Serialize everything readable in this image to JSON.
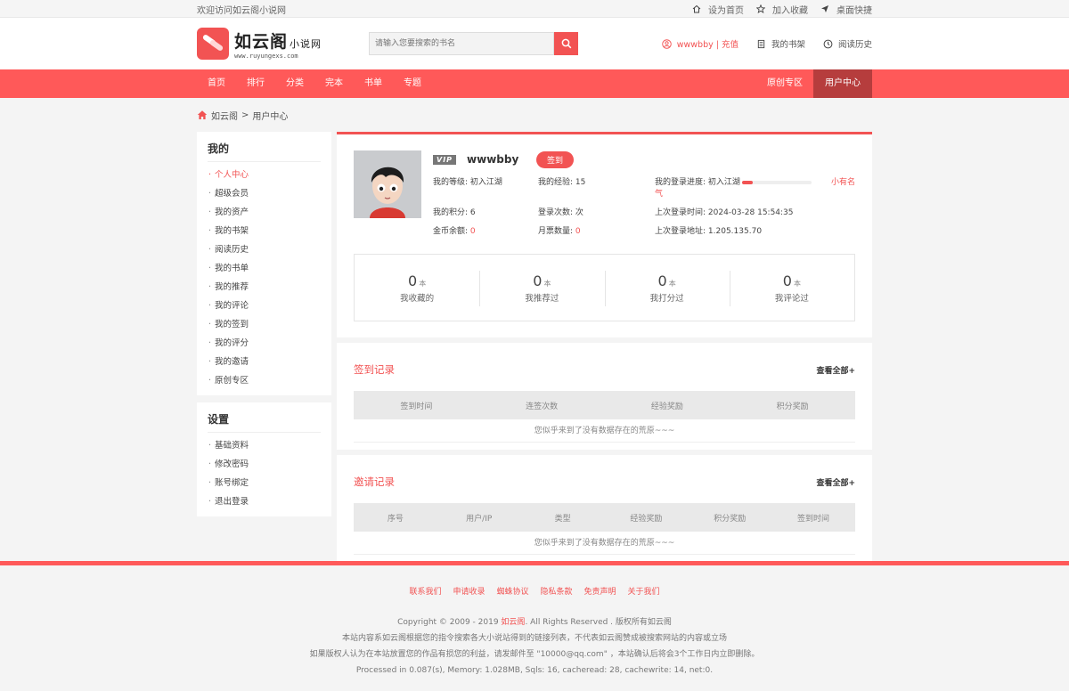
{
  "topbar": {
    "welcome": "欢迎访问如云阁小说网",
    "links": [
      "设为首页",
      "加入收藏",
      "桌面快捷"
    ]
  },
  "header": {
    "logo_title": "如云阁",
    "logo_sub": "小说网",
    "logo_url": "www.ruyungexs.com",
    "search_placeholder": "请输入您要搜索的书名",
    "user": "wwwbby | 充值",
    "bookshelf": "我的书架",
    "history": "阅读历史"
  },
  "nav": {
    "left": [
      "首页",
      "排行",
      "分类",
      "完本",
      "书单",
      "专题"
    ],
    "right": [
      "原创专区",
      "用户中心"
    ],
    "active": "用户中心"
  },
  "breadcrumb": {
    "home": "如云阁",
    "sep": ">",
    "current": "用户中心"
  },
  "sidebar": {
    "my_title": "我的",
    "my_items": [
      "个人中心",
      "超级会员",
      "我的资产",
      "我的书架",
      "阅读历史",
      "我的书单",
      "我的推荐",
      "我的评论",
      "我的签到",
      "我的评分",
      "我的邀请",
      "原创专区"
    ],
    "settings_title": "设置",
    "settings_items": [
      "基础资料",
      "修改密码",
      "账号绑定",
      "退出登录"
    ]
  },
  "profile": {
    "vip": "VIP",
    "username": "wwwbby",
    "signin": "签到",
    "level_label": "我的等级:",
    "level": "初入江湖",
    "exp_label": "我的经验:",
    "exp": "15",
    "progress_label": "我的登录进度:",
    "progress_from": "初入江湖",
    "progress_to": "小有名气",
    "progress_pct": 0.15,
    "points_label": "我的积分:",
    "points": "6",
    "logins_label": "登录次数:",
    "logins": "次",
    "last_time_label": "上次登录时间:",
    "last_time": "2024-03-28 15:54:35",
    "coins_label": "金币余额:",
    "coins": "0",
    "tickets_label": "月票数量:",
    "tickets": "0",
    "last_ip_label": "上次登录地址:",
    "last_ip": "1.205.135.70"
  },
  "counts": [
    {
      "num": "0",
      "unit": "本",
      "label": "我收藏的"
    },
    {
      "num": "0",
      "unit": "本",
      "label": "我推荐过"
    },
    {
      "num": "0",
      "unit": "本",
      "label": "我打分过"
    },
    {
      "num": "0",
      "unit": "本",
      "label": "我评论过"
    }
  ],
  "signin_record": {
    "title": "签到记录",
    "more": "查看全部+",
    "columns": [
      "签到时间",
      "连签次数",
      "经验奖励",
      "积分奖励"
    ],
    "empty": "您似乎来到了没有数据存在的荒原~~~"
  },
  "invite_record": {
    "title": "邀请记录",
    "more": "查看全部+",
    "columns": [
      "序号",
      "用户/IP",
      "类型",
      "经验奖励",
      "积分奖励",
      "签到时间"
    ],
    "empty": "您似乎来到了没有数据存在的荒原~~~"
  },
  "footer": {
    "links": [
      "联系我们",
      "申请收录",
      "蜘蛛协议",
      "隐私条款",
      "免责声明",
      "关于我们"
    ],
    "copyright_pre": "Copyright © 2009 - 2019 ",
    "copyright_brand": "如云阁",
    "copyright_post": ". All Rights Reserved . 版权所有如云阁",
    "line2": "本站内容系如云阁根据您的指令搜索各大小说站得到的链接列表，不代表如云阁赞成被搜索网站的内容或立场",
    "line3": "如果版权人认为在本站放置您的作品有损您的利益，请发邮件至 \"10000@qq.com\" ，本站确认后将会3个工作日内立即删除。",
    "line4": "Processed in 0.087(s), Memory: 1.028MB, Sqls: 16, cacheread: 28, cachewrite: 14, net:0."
  },
  "colors": {
    "accent": "#f25353",
    "nav": "#ff5959",
    "nav_active": "#b63d3d"
  }
}
